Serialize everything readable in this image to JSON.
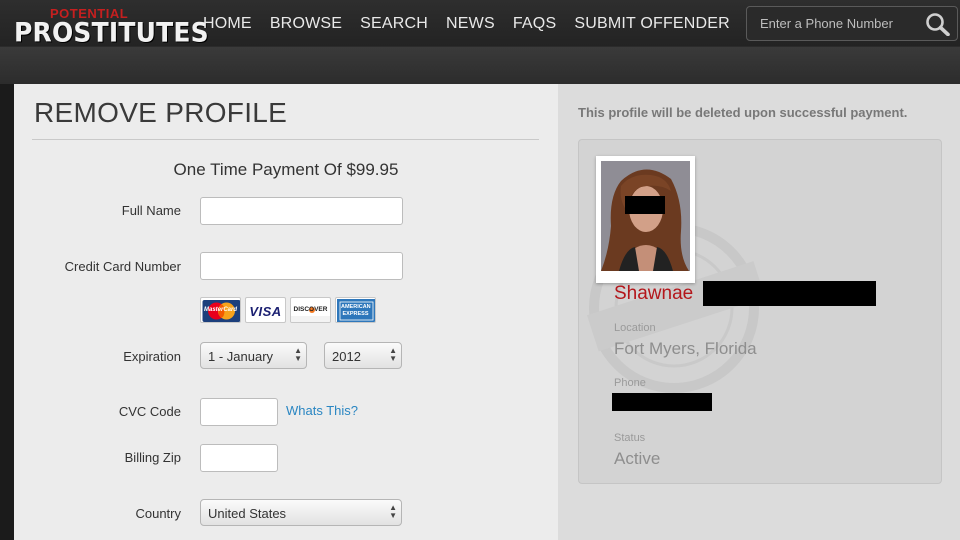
{
  "header": {
    "logo_top": "POTENTIAL",
    "logo_main": "PROSTITUTES",
    "nav": [
      "HOME",
      "BROWSE",
      "SEARCH",
      "NEWS",
      "FAQS",
      "SUBMIT OFFENDER"
    ],
    "search_placeholder": "Enter a Phone Number",
    "search_icon": "magnifier-icon"
  },
  "form": {
    "title": "REMOVE PROFILE",
    "payment_heading": "One Time Payment Of $99.95",
    "full_name_label": "Full Name",
    "full_name_value": "",
    "card_number_label": "Credit Card Number",
    "card_number_value": "",
    "cards": [
      "MasterCard",
      "VISA",
      "DISCOVER",
      "AMERICAN EXPRESS"
    ],
    "expiration_label": "Expiration",
    "exp_month": "1 - January",
    "exp_year": "2012",
    "cvc_label": "CVC Code",
    "cvc_value": "",
    "whats_this": "Whats This?",
    "zip_label": "Billing Zip",
    "zip_value": "",
    "country_label": "Country",
    "country_value": "United States"
  },
  "profile": {
    "notice": "This profile will be deleted upon successful payment.",
    "first_name": "Shawnae",
    "location_label": "Location",
    "location_value": "Fort Myers, Florida",
    "phone_label": "Phone",
    "status_label": "Status",
    "status_value": "Active"
  },
  "colors": {
    "accent_red": "#b4161b",
    "link_blue": "#2a86c2",
    "header_bg": "#2a2a2a"
  }
}
